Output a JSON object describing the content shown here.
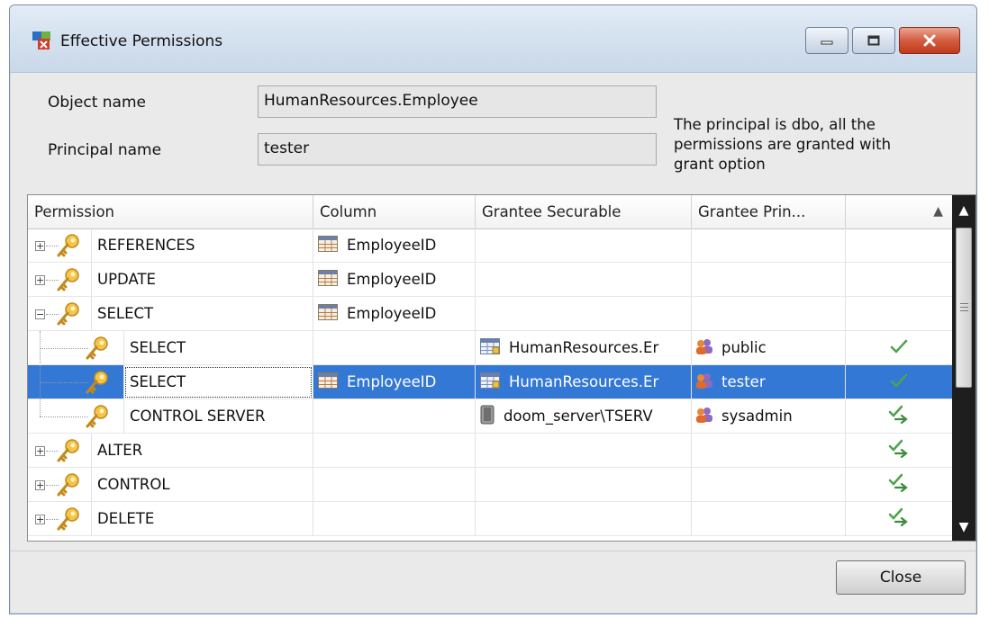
{
  "window": {
    "title": "Effective Permissions"
  },
  "form": {
    "object_label": "Object name",
    "object_value": "HumanResources.Employee",
    "principal_label": "Principal name",
    "principal_value": "tester",
    "note": "The principal is dbo, all the permissions are granted with grant option"
  },
  "grid": {
    "columns": [
      "Permission",
      "Column",
      "Grantee Securable",
      "Grantee Prin...",
      ""
    ],
    "rows": [
      {
        "level": 0,
        "expander": "+",
        "permission": "REFERENCES",
        "column": "EmployeeID",
        "securable": "",
        "principal": "",
        "mark": ""
      },
      {
        "level": 0,
        "expander": "+",
        "permission": "UPDATE",
        "column": "EmployeeID",
        "securable": "",
        "principal": "",
        "mark": ""
      },
      {
        "level": 0,
        "expander": "-",
        "permission": "SELECT",
        "column": "EmployeeID",
        "securable": "",
        "principal": "",
        "mark": ""
      },
      {
        "level": 1,
        "expander": "",
        "permission": "SELECT",
        "column": "",
        "securable": "HumanResources.Er",
        "securable_icon": "table-icon",
        "principal": "public",
        "mark": "check-icon"
      },
      {
        "level": 1,
        "expander": "",
        "permission": "SELECT",
        "column": "EmployeeID",
        "securable": "HumanResources.Er",
        "securable_icon": "table-icon",
        "principal": "tester",
        "mark": "check-icon",
        "selected": true
      },
      {
        "level": 1,
        "expander": "",
        "permission": "CONTROL SERVER",
        "column": "",
        "securable": "doom_server\\TSERV",
        "securable_icon": "server-icon",
        "principal": "sysadmin",
        "mark": "grant-option-icon"
      },
      {
        "level": 0,
        "expander": "+",
        "permission": "ALTER",
        "column": "",
        "securable": "",
        "principal": "",
        "mark": "grant-option-icon"
      },
      {
        "level": 0,
        "expander": "+",
        "permission": "CONTROL",
        "column": "",
        "securable": "",
        "principal": "",
        "mark": "grant-option-icon"
      },
      {
        "level": 0,
        "expander": "+",
        "permission": "DELETE",
        "column": "",
        "securable": "",
        "principal": "",
        "mark": "grant-option-icon"
      }
    ]
  },
  "footer": {
    "close_label": "Close"
  }
}
